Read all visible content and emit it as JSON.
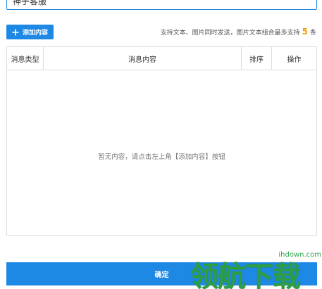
{
  "form": {
    "name_value": "神手客服"
  },
  "toolbar": {
    "add_label": "添加内容",
    "hint_prefix": "支持文本、图片同时发送，图片文本组合最多支持",
    "hint_max": "5",
    "hint_suffix": "条"
  },
  "table": {
    "columns": [
      "消息类型",
      "消息内容",
      "排序",
      "操作"
    ],
    "empty_text": "暂无内容，请点击左上角【添加内容】按钮"
  },
  "footer": {
    "confirm_label": "确定"
  },
  "watermark": {
    "text": "领航下载",
    "url": "ihdown.com"
  },
  "colors": {
    "primary": "#1e88e5",
    "accent_number": "#f39c12",
    "watermark": "#2e9e44"
  }
}
